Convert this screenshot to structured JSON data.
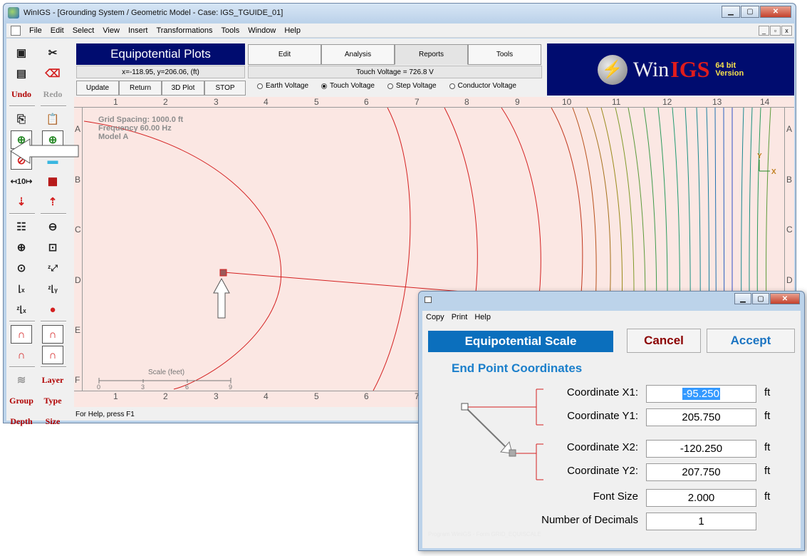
{
  "window": {
    "title": "WinIGS - [Grounding System / Geometric Model - Case: IGS_TGUIDE_01]",
    "min": "▁",
    "max": "▢",
    "close": "✕"
  },
  "menu": {
    "items": [
      "File",
      "Edit",
      "Select",
      "View",
      "Insert",
      "Transformations",
      "Tools",
      "Window",
      "Help"
    ],
    "mdi_min": "_",
    "mdi_max": "▫",
    "mdi_close": "x"
  },
  "toolbar": {
    "undo": "Undo",
    "redo": "Redo",
    "layer": "Layer",
    "type": "Type",
    "group": "Group",
    "depth": "Depth",
    "size": "Size"
  },
  "header": {
    "title": "Equipotential Plots",
    "coordinates": "x=-118.95, y=206.06, (ft)",
    "buttons": [
      "Update",
      "Return",
      "3D Plot",
      "STOP"
    ],
    "tabs": [
      "Edit",
      "Analysis",
      "Reports",
      "Tools"
    ],
    "active_tab": "Reports",
    "touch_status": "Touch Voltage = 726.8 V",
    "radios": [
      "Earth Voltage",
      "Touch Voltage",
      "Step Voltage",
      "Conductor Voltage"
    ],
    "selected_radio": "Touch Voltage"
  },
  "logo": {
    "win": "Win",
    "igs": "IGS",
    "bits": "64 bit",
    "version": "Version"
  },
  "plot": {
    "info_line1": "Grid Spacing: 1000.0 ft",
    "info_line2": "Frequency 60.00 Hz",
    "info_line3": "Model A",
    "col_labels": [
      "1",
      "2",
      "3",
      "4",
      "5",
      "6",
      "7",
      "8",
      "9",
      "10",
      "11",
      "12",
      "13",
      "14"
    ],
    "row_labels": [
      "A",
      "B",
      "C",
      "D",
      "E",
      "F"
    ],
    "scale_title": "Scale (feet)",
    "scale_ticks": [
      "0",
      "3",
      "6",
      "9"
    ],
    "axis_x": "X",
    "axis_y": "Y"
  },
  "status_bar": "For Help, press F1",
  "dialog": {
    "menu": [
      "Copy",
      "Print",
      "Help"
    ],
    "title": "Equipotential Scale",
    "cancel": "Cancel",
    "accept": "Accept",
    "section": "End Point Coordinates",
    "rows": [
      {
        "label": "Coordinate X1:",
        "value": "-95.250",
        "unit": "ft"
      },
      {
        "label": "Coordinate Y1:",
        "value": "205.750",
        "unit": "ft"
      },
      {
        "label": "Coordinate X2:",
        "value": "-120.250",
        "unit": "ft"
      },
      {
        "label": "Coordinate Y2:",
        "value": "207.750",
        "unit": "ft"
      },
      {
        "label": "Font Size",
        "value": "2.000",
        "unit": "ft"
      },
      {
        "label": "Number of Decimals",
        "value": "1",
        "unit": ""
      }
    ],
    "footer": "Program WinIGS - Form GRID_EQUISCALE",
    "colors": {
      "title_bg": "#0b6fbd",
      "section": "#1b7fcb",
      "cancel": "#8b0000",
      "accept": "#1b74c2"
    }
  },
  "colors": {
    "header_bg": "#000c6f",
    "plot_bg": "#fbe7e3",
    "contour": "#d42020"
  }
}
